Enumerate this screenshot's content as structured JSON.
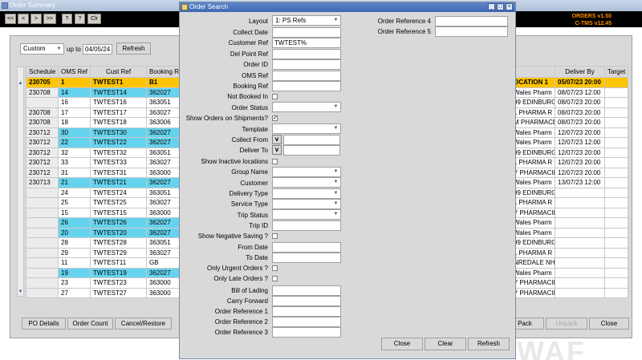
{
  "background": {
    "window_title": "Order Summary",
    "toolbar": {
      "buttons": [
        "<<",
        "<",
        ">",
        ">>",
        "?",
        "?",
        "Clr"
      ],
      "version_line1": "ORDERS v1.50",
      "version_line2": "C-TMS v12.45"
    },
    "filter": {
      "mode_value": "Custom",
      "up_to_label": "up to",
      "date_value": "04/05/24",
      "refresh_label": "Refresh"
    },
    "left_grid": {
      "columns": [
        "Schedule",
        "OMS Ref",
        "Cust Ref",
        "Booking R"
      ],
      "rows": [
        {
          "style": "sel",
          "cells": [
            "230705",
            "1",
            "TWTEST1",
            "B1"
          ]
        },
        {
          "style": "cyan",
          "cells": [
            "230708",
            "14",
            "TWTEST14",
            "362027"
          ]
        },
        {
          "style": "plain",
          "cells": [
            "",
            "16",
            "TWTEST16",
            "363051"
          ]
        },
        {
          "style": "plain",
          "cells": [
            "230708",
            "17",
            "TWTEST17",
            "363027"
          ]
        },
        {
          "style": "plain",
          "cells": [
            "230708",
            "18",
            "TWTEST18",
            "363006"
          ]
        },
        {
          "style": "cyan",
          "cells": [
            "230712",
            "30",
            "TWTEST30",
            "362027"
          ]
        },
        {
          "style": "cyan",
          "cells": [
            "230712",
            "22",
            "TWTEST22",
            "362027"
          ]
        },
        {
          "style": "plain",
          "cells": [
            "230712",
            "32",
            "TWTEST32",
            "363051"
          ]
        },
        {
          "style": "plain",
          "cells": [
            "230712",
            "33",
            "TWTEST33",
            "363027"
          ]
        },
        {
          "style": "plain",
          "cells": [
            "230712",
            "31",
            "TWTEST31",
            "363000"
          ]
        },
        {
          "style": "cyan",
          "cells": [
            "230713",
            "21",
            "TWTEST21",
            "362027"
          ]
        },
        {
          "style": "plain",
          "cells": [
            "",
            "24",
            "TWTEST24",
            "363051"
          ]
        },
        {
          "style": "plain",
          "cells": [
            "",
            "25",
            "TWTEST25",
            "363027"
          ]
        },
        {
          "style": "plain",
          "cells": [
            "",
            "15",
            "TWTEST15",
            "363000"
          ]
        },
        {
          "style": "cyan",
          "cells": [
            "",
            "26",
            "TWTEST26",
            "362027"
          ]
        },
        {
          "style": "cyan",
          "cells": [
            "",
            "20",
            "TWTEST20",
            "362027"
          ]
        },
        {
          "style": "plain",
          "cells": [
            "",
            "28",
            "TWTEST28",
            "363051"
          ]
        },
        {
          "style": "plain",
          "cells": [
            "",
            "29",
            "TWTEST29",
            "363027"
          ]
        },
        {
          "style": "plain",
          "cells": [
            "",
            "11",
            "TWTEST11",
            "GB"
          ]
        },
        {
          "style": "cyan",
          "cells": [
            "",
            "19",
            "TWTEST19",
            "362027"
          ]
        },
        {
          "style": "plain",
          "cells": [
            "",
            "23",
            "TWTEST23",
            "363000"
          ]
        },
        {
          "style": "plain",
          "cells": [
            "",
            "27",
            "TWTEST27",
            "363000"
          ]
        }
      ]
    },
    "right_grid": {
      "columns": [
        "",
        "Deliver By",
        "Target"
      ],
      "rows": [
        {
          "style": "sel",
          "cells": [
            "OCATION 1",
            "05/07/23 20:00",
            ""
          ]
        },
        {
          "style": "plain",
          "cells": [
            "Wales Pharm",
            "08/07/23 12:00",
            ""
          ]
        },
        {
          "style": "plain",
          "cells": [
            "99 EDINBURG",
            "08/07/23 20:00",
            ""
          ]
        },
        {
          "style": "plain",
          "cells": [
            "L PHARMA R",
            "08/07/23 20:00",
            ""
          ]
        },
        {
          "style": "plain",
          "cells": [
            "M PHARMACE",
            "08/07/23 20:00",
            ""
          ]
        },
        {
          "style": "plain",
          "cells": [
            "Wales Pharm",
            "12/07/23 20:00",
            ""
          ]
        },
        {
          "style": "plain",
          "cells": [
            "Wales Pharm",
            "12/07/23 12:00",
            ""
          ]
        },
        {
          "style": "plain",
          "cells": [
            "99 EDINBURG",
            "12/07/23 20:00",
            ""
          ]
        },
        {
          "style": "plain",
          "cells": [
            "L PHARMA R",
            "12/07/23 20:00",
            ""
          ]
        },
        {
          "style": "plain",
          "cells": [
            "Y PHARMACIE",
            "12/07/23 20:00",
            ""
          ]
        },
        {
          "style": "plain",
          "cells": [
            "Wales Pharm",
            "13/07/23 12:00",
            ""
          ]
        },
        {
          "style": "plain",
          "cells": [
            "99 EDINBURG",
            "",
            ""
          ]
        },
        {
          "style": "plain",
          "cells": [
            "L PHARMA R",
            "",
            ""
          ]
        },
        {
          "style": "plain",
          "cells": [
            "Y PHARMACIE",
            "",
            ""
          ]
        },
        {
          "style": "plain",
          "cells": [
            "Wales Pharm",
            "",
            ""
          ]
        },
        {
          "style": "plain",
          "cells": [
            "Wales Pharm",
            "",
            ""
          ]
        },
        {
          "style": "plain",
          "cells": [
            "99 EDINBURG",
            "",
            ""
          ]
        },
        {
          "style": "plain",
          "cells": [
            "L PHARMA R",
            "",
            ""
          ]
        },
        {
          "style": "plain",
          "cells": [
            "NREDALE NH",
            "",
            ""
          ]
        },
        {
          "style": "plain",
          "cells": [
            "Wales Pharm",
            "",
            ""
          ]
        },
        {
          "style": "plain",
          "cells": [
            "Y PHARMACIE",
            "",
            ""
          ]
        },
        {
          "style": "plain",
          "cells": [
            "Y PHARMACIE",
            "",
            ""
          ]
        }
      ]
    },
    "bottom_buttons": {
      "po_details": "PO Details",
      "order_count": "Order Count",
      "cancel_restore": "Cancel/Restore",
      "pack": "Pack",
      "unpack": "Unpack",
      "close": "Close"
    },
    "watermark": "WAF"
  },
  "dialog": {
    "title": "Order Search",
    "layout": {
      "label": "Layout",
      "value": "1: PS Refs"
    },
    "collect_date": {
      "label": "Collect Date",
      "value": ""
    },
    "customer_ref": {
      "label": "Customer Ref",
      "value": "TWTEST%"
    },
    "del_point_ref": {
      "label": "Del Point Ref",
      "value": ""
    },
    "order_id": {
      "label": "Order ID",
      "value": ""
    },
    "oms_ref": {
      "label": "OMS Ref",
      "value": ""
    },
    "booking_ref": {
      "label": "Booking Ref",
      "value": ""
    },
    "not_booked_in": {
      "label": "Not Booked In",
      "checked": false
    },
    "order_status": {
      "label": "Order Status",
      "value": ""
    },
    "show_orders_on_shipments": {
      "label": "Show Orders on Shipments?",
      "checked": true
    },
    "template": {
      "label": "Template",
      "value": ""
    },
    "collect_from": {
      "label": "Collect From",
      "button": "v",
      "value": ""
    },
    "deliver_to": {
      "label": "Deliver To",
      "button": "v",
      "value": ""
    },
    "show_inactive_locations": {
      "label": "Show Inactive locations",
      "checked": false
    },
    "group_name": {
      "label": "Group Name",
      "value": ""
    },
    "customer": {
      "label": "Customer",
      "value": ""
    },
    "delivery_type": {
      "label": "Delivery Type",
      "value": ""
    },
    "service_type": {
      "label": "Service Type",
      "value": ""
    },
    "trip_status": {
      "label": "Trip Status",
      "value": ""
    },
    "trip_id": {
      "label": "Trip ID",
      "value": ""
    },
    "show_negative_saving": {
      "label": "Show Negative Saving ?",
      "checked": false
    },
    "from_date": {
      "label": "From Date",
      "value": ""
    },
    "to_date": {
      "label": "To Date",
      "value": ""
    },
    "only_urgent_orders": {
      "label": "Only Urgent Orders ?",
      "checked": false
    },
    "only_late_orders": {
      "label": "Only Late Orders ?",
      "checked": false
    },
    "bill_of_lading": {
      "label": "Bill of Lading",
      "value": ""
    },
    "carry_forward": {
      "label": "Carry Forward",
      "value": ""
    },
    "order_reference_1": {
      "label": "Order Reference 1",
      "value": ""
    },
    "order_reference_2": {
      "label": "Order Reference 2",
      "value": ""
    },
    "order_reference_3": {
      "label": "Order Reference 3",
      "value": ""
    },
    "order_reference_4": {
      "label": "Order Reference 4",
      "value": ""
    },
    "order_reference_5": {
      "label": "Order Reference 5",
      "value": ""
    },
    "buttons": {
      "close": "Close",
      "clear": "Clear",
      "refresh": "Refresh"
    }
  }
}
